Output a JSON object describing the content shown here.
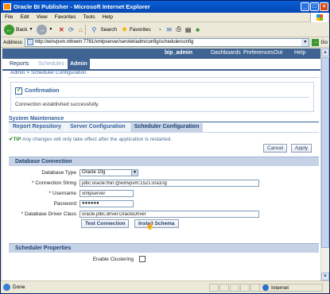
{
  "window": {
    "title": "Oracle BI Publisher - Microsoft Internet Explorer",
    "controls": [
      "_",
      "□",
      "×"
    ]
  },
  "menu": [
    "File",
    "Edit",
    "View",
    "Favorites",
    "Tools",
    "Help"
  ],
  "toolbar": {
    "back": "Back",
    "search": "Search",
    "favorites": "Favorites"
  },
  "address": {
    "label": "Address",
    "url": "http://winvpvm.nttnwm:7781/xmlpserver/servlet/adm/config/schedulerconfig",
    "go": "Go"
  },
  "app": {
    "user": "bip_admin",
    "nav": [
      "Dashboards",
      "Preferences",
      "Out",
      "Help"
    ],
    "tabs": [
      "Reports",
      "Schedules",
      "Admin"
    ],
    "breadcrumb": {
      "link": "Admin",
      "sep": ">",
      "current": "Scheduler Configuration"
    }
  },
  "confirmation": {
    "title": "Confirmation",
    "message": "Connection established successfully."
  },
  "maintenance": {
    "title": "System Maintenance",
    "tabs": [
      "Report Repository",
      "Server Configuration",
      "Scheduler Configuration"
    ],
    "tip_label": "TIP",
    "tip_text": "Any changes will only take effect after the application is restarted.",
    "cancel": "Cancel",
    "apply": "Apply"
  },
  "db": {
    "section": "Database Connection",
    "type_label": "Database Type",
    "type_value": "Oracle 10g",
    "conn_label": "* Connection String",
    "conn_value": "jdbc:oracle:thin:@winvpvm:1521:ora10g",
    "user_label": "* Username",
    "user_value": "xmlpserver",
    "pass_label": "Password",
    "pass_value": "●●●●●●",
    "driver_label": "* Database Driver Class",
    "driver_value": "oracle.jdbc.driver.OracleDriver",
    "test_btn": "Test Connection",
    "install_btn": "Install Schema"
  },
  "scheduler": {
    "section": "Scheduler Properties",
    "clustering_label": "Enable Clustering"
  },
  "status": {
    "text": "Done",
    "zone": "Internet"
  }
}
